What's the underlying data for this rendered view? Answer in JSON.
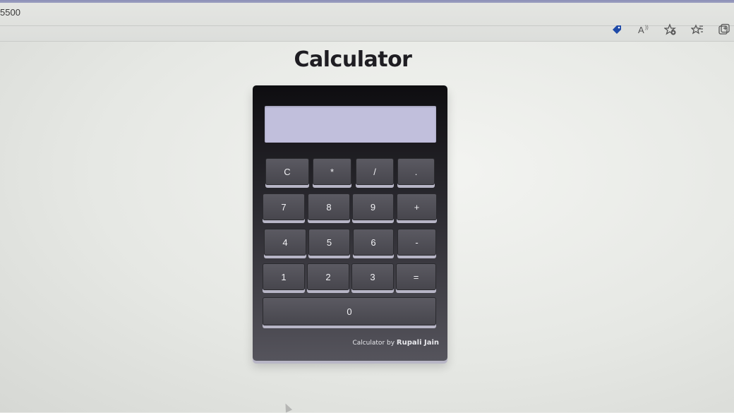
{
  "browser": {
    "address_fragment": "5500",
    "toolbar_icons": [
      "tag-icon",
      "read-aloud-icon",
      "favorite-add-icon",
      "favorites-icon",
      "collections-icon"
    ]
  },
  "page": {
    "title": "Calculator"
  },
  "calculator": {
    "display_value": "",
    "keys": {
      "clear": "C",
      "multiply": "*",
      "divide": "/",
      "dot": ".",
      "seven": "7",
      "eight": "8",
      "nine": "9",
      "plus": "+",
      "four": "4",
      "five": "5",
      "six": "6",
      "minus": "-",
      "one": "1",
      "two": "2",
      "three": "3",
      "equals": "=",
      "zero": "0"
    },
    "footer": {
      "prefix": "Calculator by",
      "author": "Rupali Jain"
    }
  },
  "colors": {
    "display_bg": "#c1bfdc",
    "key_bg": "#4f4e55",
    "key_shadow": "#b7b5c6",
    "title": "#1e1d22"
  }
}
